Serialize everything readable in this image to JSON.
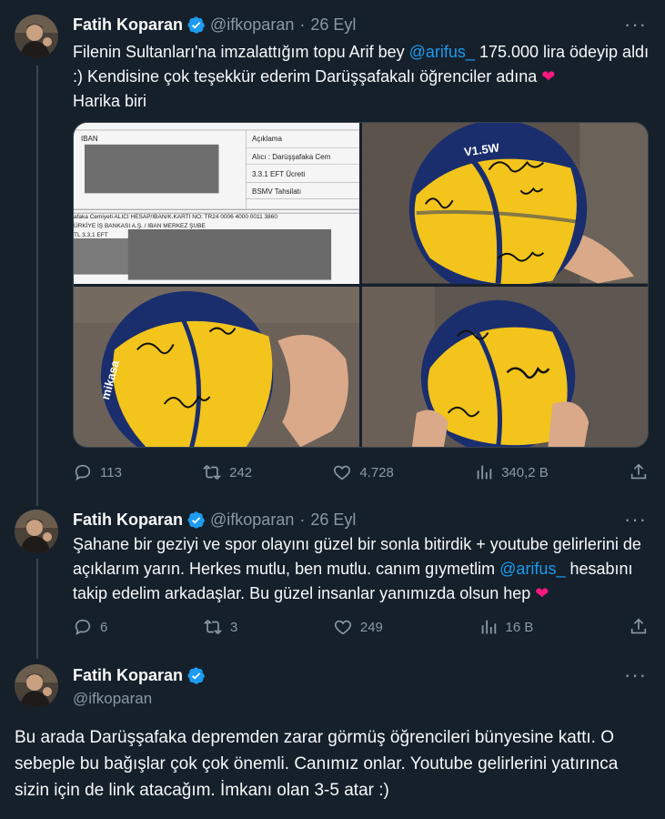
{
  "tweets": [
    {
      "name": "Fatih Koparan",
      "handle": "@ifkoparan",
      "date": "26 Eyl",
      "text_parts": {
        "a": "Filenin Sultanları'na imzalattığım topu Arif bey ",
        "mention": "@arifus_",
        "b": " 175.000 lira ödeyip aldı :) Kendisine çok teşekkür ederim Darüşşafakalı öğrenciler adına ",
        "c": "Harika biri"
      },
      "media": {
        "doc_labels": {
          "iban": "IBAN",
          "aciklama": "Açıklama",
          "alici": "Alıcı : Darüşşafaka Cem",
          "eft": "3.3.1 EFT Ücreti",
          "bsmv": "BSMV Tahsilatı",
          "line1": "afaka Cemiyeti  ALICI HESAP/IBAN/K.KARTI NO: TR24 0006 4000 0011 3860",
          "line2": "ÜRKİYE İŞ BANKASI A.Ş. / IBAN MERKEZ ŞUBE",
          "line3": "TL  3.3.1 EFT"
        },
        "ball_brand": "V1.5W",
        "ball_logo": "mikasa"
      },
      "stats": {
        "replies": "113",
        "retweets": "242",
        "likes": "4.728",
        "views": "340,2 B"
      }
    },
    {
      "name": "Fatih Koparan",
      "handle": "@ifkoparan",
      "date": "26 Eyl",
      "text_parts": {
        "a": "Şahane bir geziyi ve spor olayını güzel bir sonla bitirdik + youtube gelirlerini de açıklarım yarın. Herkes mutlu, ben mutlu. canım gıymetlim ",
        "mention": "@arifus_",
        "b": " hesabını takip edelim arkadaşlar. Bu güzel insanlar yanımızda olsun hep "
      },
      "stats": {
        "replies": "6",
        "retweets": "3",
        "likes": "249",
        "views": "16 B"
      }
    },
    {
      "name": "Fatih Koparan",
      "handle": "@ifkoparan",
      "text": "Bu arada Darüşşafaka depremden zarar görmüş öğrencileri bünyesine kattı. O sebeple bu bağışlar çok çok önemli. Canımız onlar. Youtube gelirlerini yatırınca sizin için de link atacağım. İmkanı olan 3-5 atar :)"
    }
  ],
  "icons": {
    "heart_glyph": "❤",
    "more_glyph": "···"
  },
  "colors": {
    "background": "#15202b",
    "accent": "#1d9bf0",
    "muted": "#8b98a5",
    "heart": "#f91880"
  }
}
